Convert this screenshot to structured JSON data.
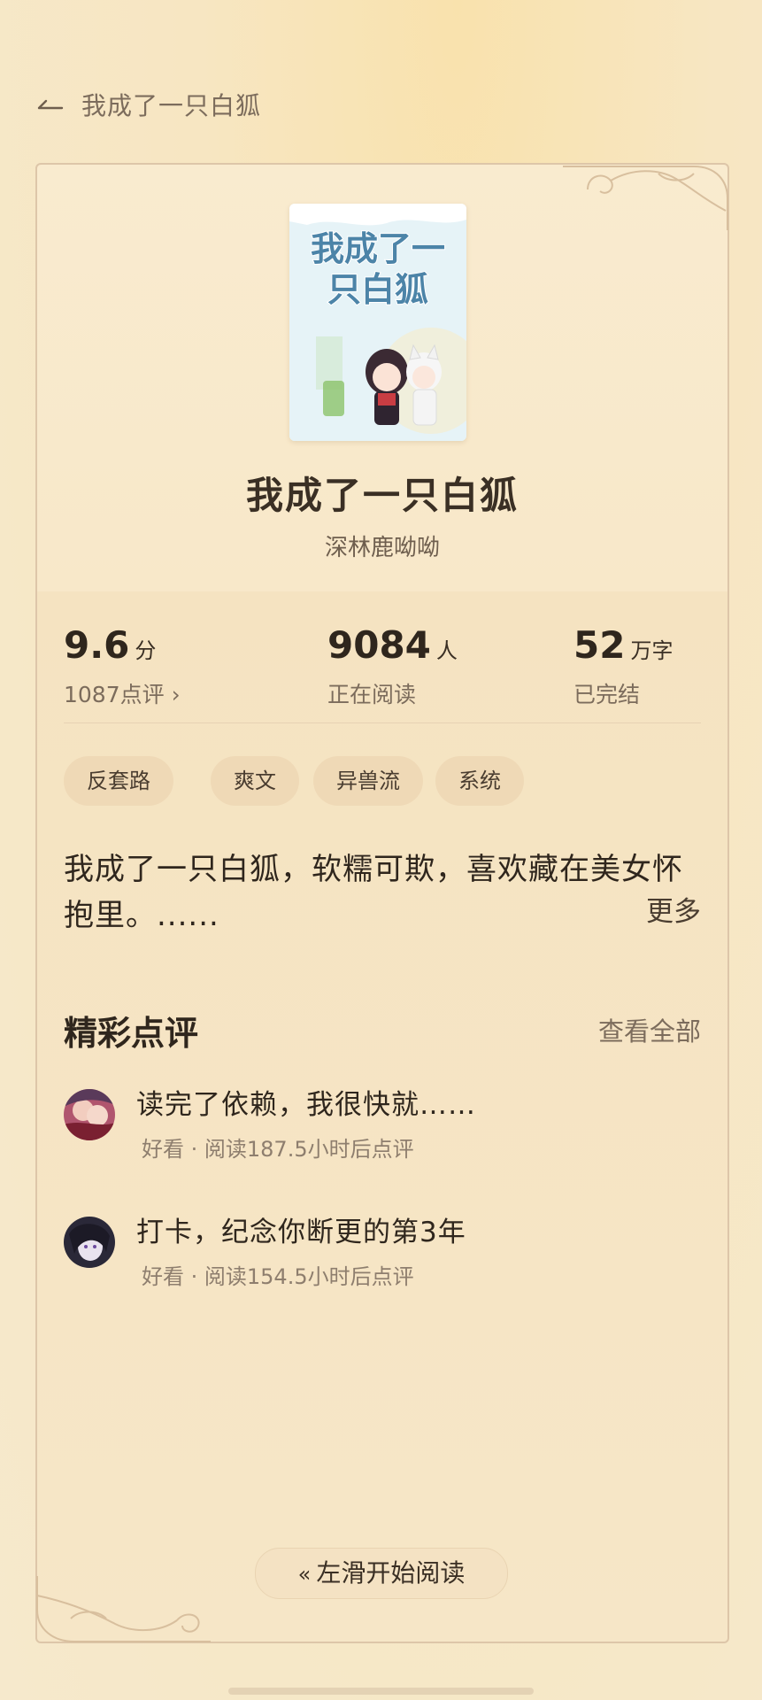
{
  "header": {
    "title": "我成了一只白狐"
  },
  "book": {
    "cover_text": "我成了一只白狐",
    "title": "我成了一只白狐",
    "author": "深林鹿呦呦"
  },
  "stats": {
    "rating": {
      "value": "9.6",
      "unit": "分",
      "sub": "1087点评 ›"
    },
    "readers": {
      "value": "9084",
      "unit": "人",
      "sub": "正在阅读"
    },
    "words": {
      "value": "52",
      "unit": "万字",
      "sub": "已完结"
    }
  },
  "tags": [
    "反套路",
    "爽文",
    "异兽流",
    "系统"
  ],
  "description": {
    "text": "我成了一只白狐，软糯可欺，喜欢藏在美女怀抱里。......",
    "more_label": "更多"
  },
  "reviews_section": {
    "title": "精彩点评",
    "see_all_label": "查看全部",
    "items": [
      {
        "text": "读完了依赖，我很快就……",
        "meta": "好看 · 阅读187.5小时后点评"
      },
      {
        "text": "打卡，纪念你断更的第3年",
        "meta": "好看 · 阅读154.5小时后点评"
      }
    ]
  },
  "start_button": {
    "label": "左滑开始阅读",
    "icon": "double-chevron-left-icon"
  },
  "colors": {
    "background": "#f7e6c2",
    "card": "#f8e8c9",
    "tag": "#efd9b6",
    "text_primary": "#2f261d",
    "text_secondary": "#7c6c5c"
  }
}
